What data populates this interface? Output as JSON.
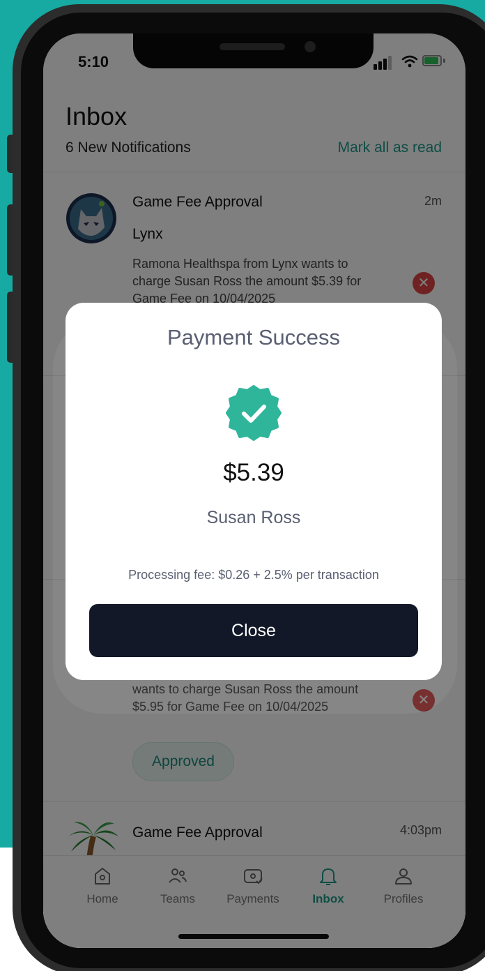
{
  "status_bar": {
    "time": "5:10"
  },
  "header": {
    "title": "Inbox",
    "subtitle": "6 New Notifications",
    "mark_all": "Mark all as read"
  },
  "notifications": [
    {
      "title": "Game Fee Approval",
      "team": "Lynx",
      "time": "2m",
      "body": "Ramona Healthspa from Lynx wants to charge Susan Ross the amount $5.39 for Game Fee on 10/04/2025",
      "logo_icon": "lynx-logo-icon"
    },
    {
      "body": "wants to charge Susan Ross the amount $5.95 for Game Fee on 10/04/2025",
      "status": "Approved"
    },
    {
      "title": "Game Fee Approval",
      "time": "4:03pm",
      "logo_icon": "palm-tree-icon"
    }
  ],
  "tabs": [
    {
      "label": "Home",
      "icon": "home-icon"
    },
    {
      "label": "Teams",
      "icon": "teams-icon"
    },
    {
      "label": "Payments",
      "icon": "payments-icon"
    },
    {
      "label": "Inbox",
      "icon": "bell-icon",
      "active": true
    },
    {
      "label": "Profiles",
      "icon": "profile-icon"
    }
  ],
  "modal": {
    "title": "Payment Success",
    "amount": "$5.39",
    "name": "Susan Ross",
    "fee_note": "Processing fee: $0.26 + 2.5% per transaction",
    "close_label": "Close"
  },
  "colors": {
    "background_teal": "#16aaa2",
    "accent": "#1f9a8a",
    "check_badge": "#2fb59a",
    "close_button": "#121827",
    "reject": "#e04545"
  }
}
